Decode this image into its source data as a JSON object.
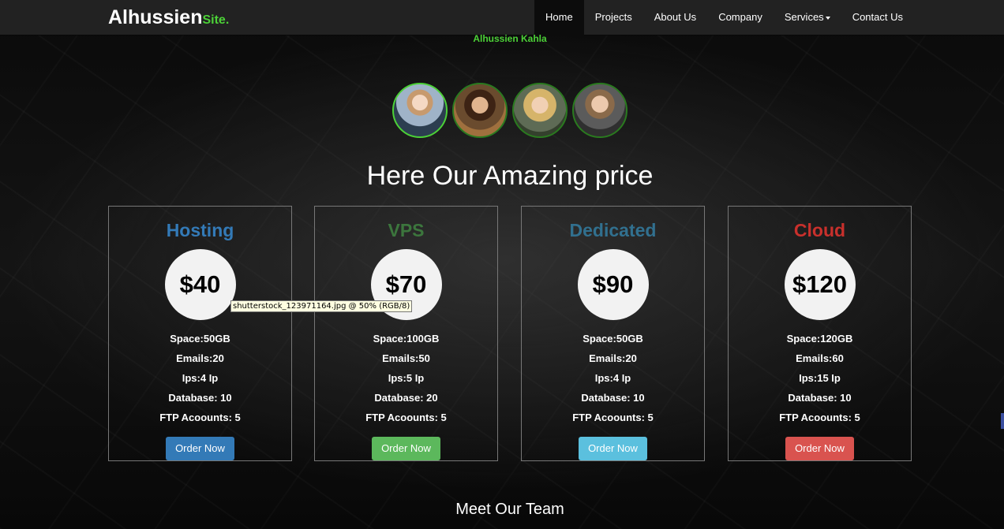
{
  "brand": {
    "name": "Alhussien",
    "suffix": "Site."
  },
  "nav": {
    "items": [
      {
        "label": "Home"
      },
      {
        "label": "Projects"
      },
      {
        "label": "About Us"
      },
      {
        "label": "Company"
      },
      {
        "label": "Services"
      },
      {
        "label": "Contact Us"
      }
    ]
  },
  "team_member_name": "Alhussien Kahla",
  "avatars": [
    "avatar-1",
    "avatar-2",
    "avatar-3",
    "avatar-4"
  ],
  "pricing": {
    "title": "Here Our Amazing price",
    "plans": [
      {
        "name": "Hosting",
        "price": "$40",
        "space": "Space:50GB",
        "emails": "Emails:20",
        "ips": "Ips:4 Ip",
        "database": "Database: 10",
        "ftp": "FTP Acoounts: 5",
        "button": "Order Now",
        "accent": "#337ab7",
        "button_color": "#337ab7"
      },
      {
        "name": "VPS",
        "price": "$70",
        "space": "Space:100GB",
        "emails": "Emails:50",
        "ips": "Ips:5 Ip",
        "database": "Database: 20",
        "ftp": "FTP Acoounts: 5",
        "button": "Order Now",
        "accent": "#3c763d",
        "button_color": "#5cb85c"
      },
      {
        "name": "Dedicated",
        "price": "$90",
        "space": "Space:50GB",
        "emails": "Emails:20",
        "ips": "Ips:4 Ip",
        "database": "Database: 10",
        "ftp": "FTP Acoounts: 5",
        "button": "Order Now",
        "accent": "#31708f",
        "button_color": "#5bc0de"
      },
      {
        "name": "Cloud",
        "price": "$120",
        "space": "Space:120GB",
        "emails": "Emails:60",
        "ips": "Ips:15 Ip",
        "database": "Database: 10",
        "ftp": "FTP Acoounts: 5",
        "button": "Order Now",
        "accent": "#c9302c",
        "button_color": "#d9534f"
      }
    ]
  },
  "tooltip": "shutterstock_123971164.jpg @ 50% (RGB/8)",
  "team_title": "Meet Our Team"
}
